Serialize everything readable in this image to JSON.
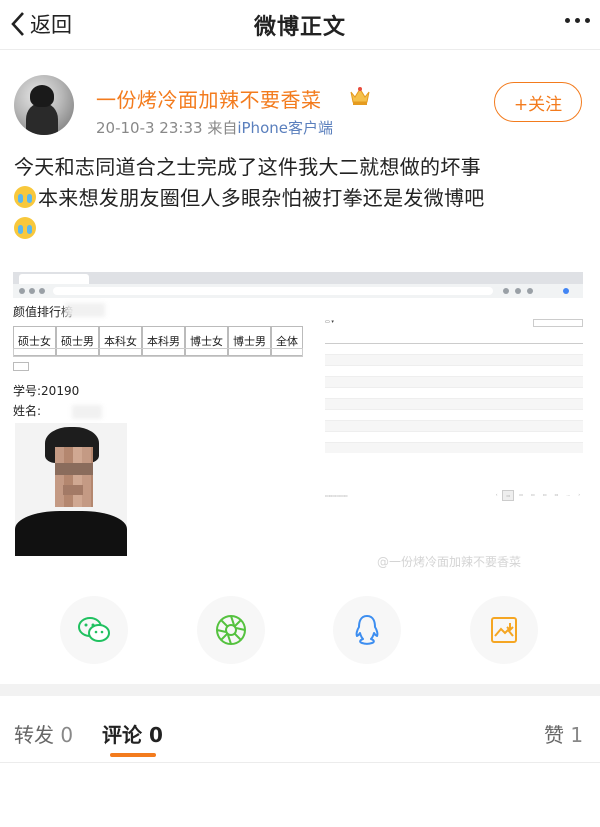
{
  "nav": {
    "back_label": "返回",
    "title": "微博正文"
  },
  "author": {
    "name": "一份烤冷面加辣不要香菜",
    "time": "20-10-3 23:33",
    "source_prefix": "来自",
    "device": "iPhone客户端",
    "follow_label": "+关注"
  },
  "post": {
    "line1": "今天和志同道合之士完成了这件我大二就想做的坏事",
    "line2": "本来想发朋友圈但人多眼杂怕被打拳还是发微博吧"
  },
  "screenshot": {
    "page_title": "颜值排行榜",
    "filters": [
      "硕士女",
      "硕士男",
      "本科女",
      "本科男",
      "博士女",
      "博士男",
      "全体"
    ],
    "student_id_label": "学号:20190",
    "name_label": "姓名:",
    "watermark": "@一份烤冷面加辣不要香菜"
  },
  "share": {
    "items": [
      "wechat-icon",
      "moments-icon",
      "qq-icon",
      "save-image-icon"
    ],
    "colors": {
      "wechat": "#20c160",
      "moments": "#55c23f",
      "qq": "#3d8ef0",
      "save": "#f5a623"
    }
  },
  "tabs": {
    "repost_label": "转发",
    "repost_count": "0",
    "comment_label": "评论",
    "comment_count": "0",
    "like_label": "赞",
    "like_count": "1"
  },
  "theme": {
    "accent": "#f37b1d",
    "link": "#5a7fbd"
  }
}
